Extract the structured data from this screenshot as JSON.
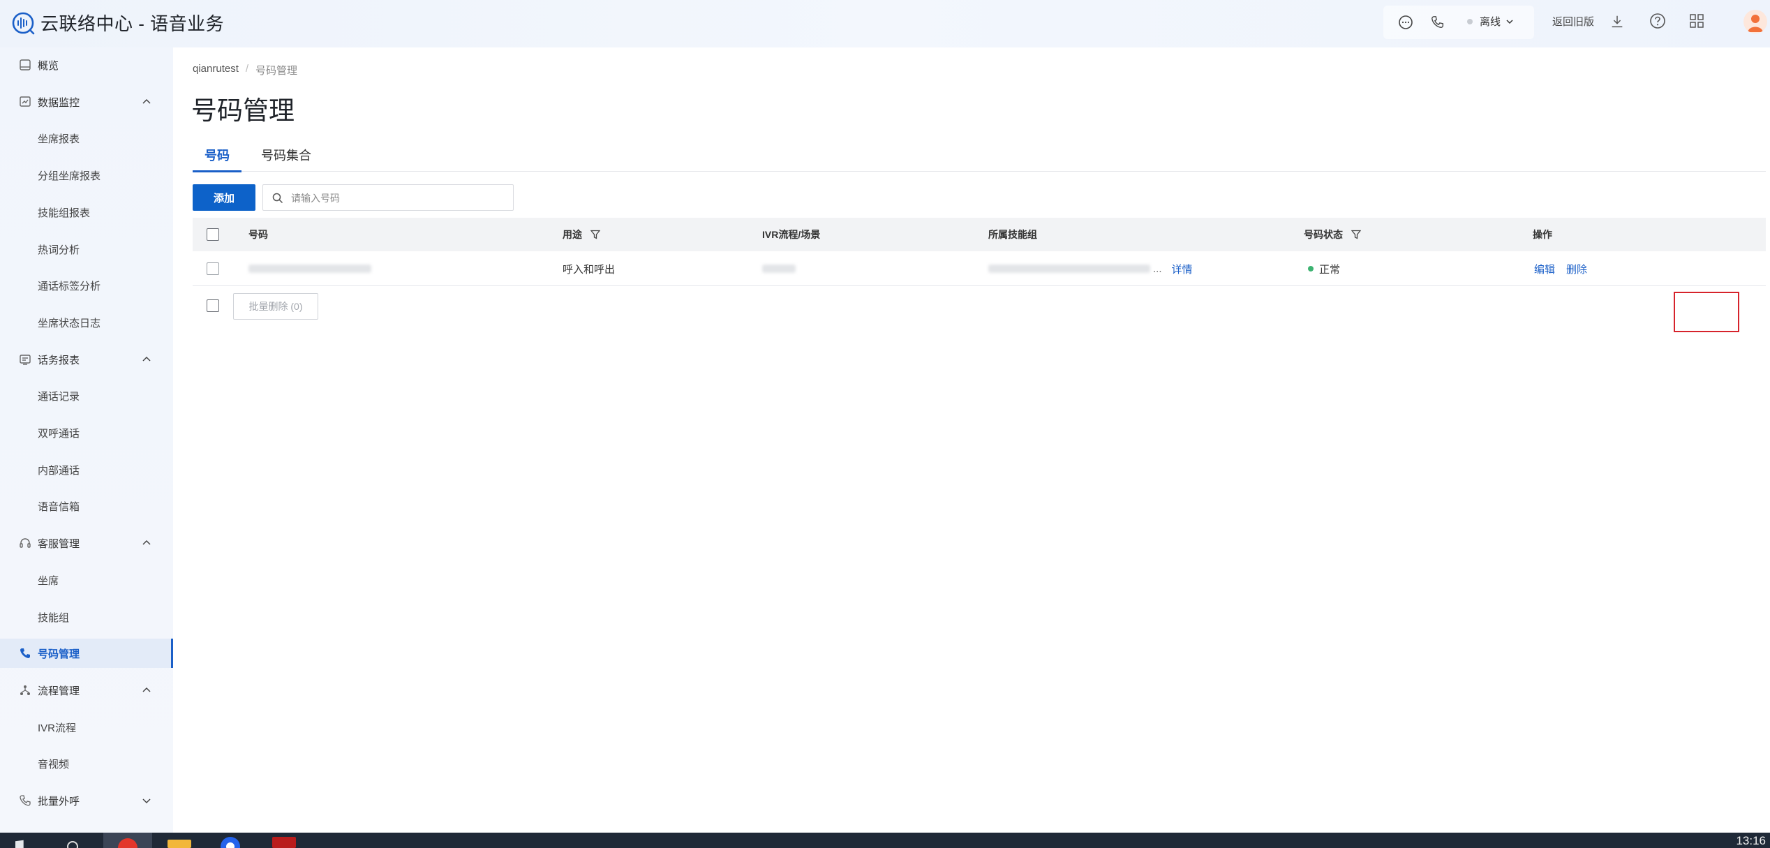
{
  "app": {
    "title": "云联络中心 - 语音业务",
    "brand_color": "#1a5fc8"
  },
  "header": {
    "status_label": "离线",
    "legacy_link": "返回旧版",
    "icons": [
      "chat-icon",
      "phone-icon",
      "download-icon",
      "help-icon",
      "apps-grid-icon"
    ]
  },
  "sidebar": {
    "items": [
      {
        "label": "概览",
        "icon": "overview-icon",
        "type": "top"
      },
      {
        "label": "数据监控",
        "icon": "monitor-icon",
        "type": "group"
      },
      {
        "label": "坐席报表",
        "type": "sub"
      },
      {
        "label": "分组坐席报表",
        "type": "sub"
      },
      {
        "label": "技能组报表",
        "type": "sub"
      },
      {
        "label": "热词分析",
        "type": "sub"
      },
      {
        "label": "通话标签分析",
        "type": "sub"
      },
      {
        "label": "坐席状态日志",
        "type": "sub"
      },
      {
        "label": "话务报表",
        "icon": "report-icon",
        "type": "group"
      },
      {
        "label": "通话记录",
        "type": "sub"
      },
      {
        "label": "双呼通话",
        "type": "sub"
      },
      {
        "label": "内部通话",
        "type": "sub"
      },
      {
        "label": "语音信箱",
        "type": "sub"
      },
      {
        "label": "客服管理",
        "icon": "headset-icon",
        "type": "group"
      },
      {
        "label": "坐席",
        "type": "sub"
      },
      {
        "label": "技能组",
        "type": "sub"
      },
      {
        "label": "号码管理",
        "icon": "phone-icon",
        "type": "top",
        "active": true
      },
      {
        "label": "流程管理",
        "icon": "flow-icon",
        "type": "group"
      },
      {
        "label": "IVR流程",
        "type": "sub"
      },
      {
        "label": "音视频",
        "type": "sub"
      },
      {
        "label": "批量外呼",
        "icon": "batch-call-icon",
        "type": "group-collapsed"
      }
    ]
  },
  "breadcrumb": {
    "root": "qianrutest",
    "sep": "/",
    "current": "号码管理"
  },
  "page": {
    "title": "号码管理",
    "tabs": [
      {
        "label": "号码",
        "active": true
      },
      {
        "label": "号码集合",
        "active": false
      }
    ],
    "add_button": "添加",
    "search_placeholder": "请输入号码"
  },
  "table": {
    "columns": [
      "号码",
      "用途",
      "IVR流程/场景",
      "所属技能组",
      "号码状态",
      "操作"
    ],
    "rows": [
      {
        "usage": "呼入和呼出",
        "detail_link": "详情",
        "ellipsis": "...",
        "status": "正常",
        "edit": "编辑",
        "delete": "删除"
      }
    ],
    "bulk_delete": "批量删除 (0)"
  },
  "taskbar": {
    "clock": "13:16"
  }
}
